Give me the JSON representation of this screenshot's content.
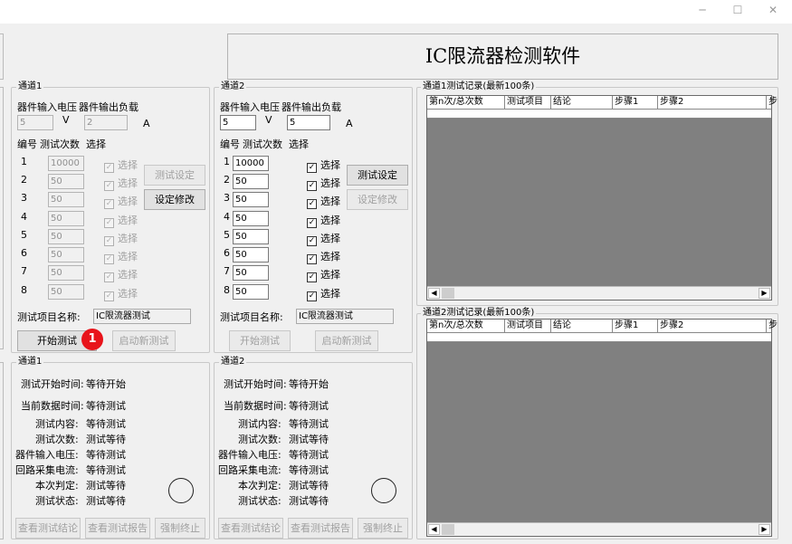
{
  "window": {
    "minimize": "─",
    "maximize": "☐",
    "close": "✕"
  },
  "app_title": "IC限流器检测软件",
  "channels": [
    {
      "group_title": "通道1",
      "input_label": "器件输入电压",
      "output_label": "器件输出负载",
      "voltage": "5",
      "voltage_unit": "V",
      "load": "2",
      "load_unit": "A",
      "col_no": "编号",
      "col_count": "测试次数",
      "col_select": "选择",
      "rows": [
        {
          "no": "1",
          "count": "10000",
          "select": "选择"
        },
        {
          "no": "2",
          "count": "50",
          "select": "选择"
        },
        {
          "no": "3",
          "count": "50",
          "select": "选择"
        },
        {
          "no": "4",
          "count": "50",
          "select": "选择"
        },
        {
          "no": "5",
          "count": "50",
          "select": "选择"
        },
        {
          "no": "6",
          "count": "50",
          "select": "选择"
        },
        {
          "no": "7",
          "count": "50",
          "select": "选择"
        },
        {
          "no": "8",
          "count": "50",
          "select": "选择"
        }
      ],
      "set_button": "测试设定",
      "modify_button": "设定修改",
      "name_label": "测试项目名称:",
      "name_value": "IC限流器测试",
      "start_button": "开始测试",
      "new_button": "启动新测试"
    },
    {
      "group_title": "通道2",
      "input_label": "器件输入电压",
      "output_label": "器件输出负载",
      "voltage": "5",
      "voltage_unit": "V",
      "load": "5",
      "load_unit": "A",
      "col_no": "编号",
      "col_count": "测试次数",
      "col_select": "选择",
      "rows": [
        {
          "no": "1",
          "count": "10000",
          "select": "选择"
        },
        {
          "no": "2",
          "count": "50",
          "select": "选择"
        },
        {
          "no": "3",
          "count": "50",
          "select": "选择"
        },
        {
          "no": "4",
          "count": "50",
          "select": "选择"
        },
        {
          "no": "5",
          "count": "50",
          "select": "选择"
        },
        {
          "no": "6",
          "count": "50",
          "select": "选择"
        },
        {
          "no": "7",
          "count": "50",
          "select": "选择"
        },
        {
          "no": "8",
          "count": "50",
          "select": "选择"
        }
      ],
      "set_button": "测试设定",
      "modify_button": "设定修改",
      "name_label": "测试项目名称:",
      "name_value": "IC限流器测试",
      "start_button": "开始测试",
      "new_button": "启动新测试"
    }
  ],
  "status": [
    {
      "group_title": "通道1",
      "start_time_label": "测试开始时间:",
      "start_time": "等待开始",
      "current_data_label": "当前数据时间:",
      "current_data": "等待测试",
      "content_label": "测试内容:",
      "content": "等待测试",
      "times_label": "测试次数:",
      "times": "测试等待",
      "voltage_label": "器件输入电压:",
      "voltage": "等待测试",
      "current_label": "回路采集电流:",
      "current": "等待测试",
      "judge_label": "本次判定:",
      "judge": "测试等待",
      "state_label": "测试状态:",
      "state": "测试等待",
      "view_result": "查看测试结论",
      "view_report": "查看测试报告",
      "force_stop": "强制终止"
    },
    {
      "group_title": "通道2",
      "start_time_label": "测试开始时间:",
      "start_time": "等待开始",
      "current_data_label": "当前数据时间:",
      "current_data": "等待测试",
      "content_label": "测试内容:",
      "content": "等待测试",
      "times_label": "测试次数:",
      "times": "测试等待",
      "voltage_label": "器件输入电压:",
      "voltage": "等待测试",
      "current_label": "回路采集电流:",
      "current": "等待测试",
      "judge_label": "本次判定:",
      "judge": "测试等待",
      "state_label": "测试状态:",
      "state": "测试等待",
      "view_result": "查看测试结论",
      "view_report": "查看测试报告",
      "force_stop": "强制终止"
    }
  ],
  "records": [
    {
      "title": "通道1测试记录(最新100条)",
      "columns": [
        "第n次/总次数",
        "测试项目",
        "结论",
        "步骤1",
        "步骤2",
        "步"
      ]
    },
    {
      "title": "通道2测试记录(最新100条)",
      "columns": [
        "第n次/总次数",
        "测试项目",
        "结论",
        "步骤1",
        "步骤2",
        "步"
      ]
    }
  ],
  "badge": "1",
  "scroll": {
    "left": "◀",
    "right": "▶"
  }
}
